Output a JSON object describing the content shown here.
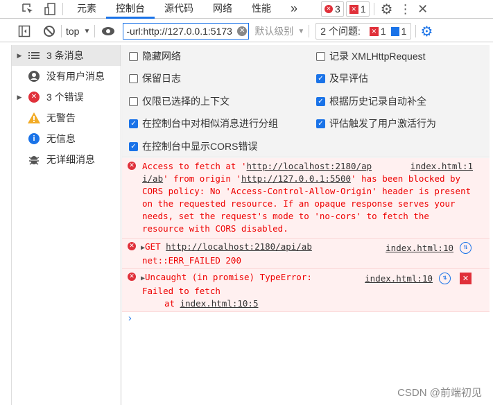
{
  "tabbar": {
    "tabs": [
      "元素",
      "控制台",
      "源代码",
      "网络",
      "性能"
    ],
    "more": "»",
    "error_count": "3",
    "issue_count": "1",
    "active_tab": "控制台"
  },
  "toolbar": {
    "context": "top",
    "filter_value": "-url:http://127.0.0.1:5173",
    "level": "默认级别",
    "issues_label": "2 个问题:",
    "issues_error": "1",
    "issues_info": "1"
  },
  "sidebar": {
    "items": [
      {
        "label": "3 条消息",
        "icon": "list-icon",
        "expandable": true,
        "selected": true
      },
      {
        "label": "没有用户消息",
        "icon": "user-icon",
        "expandable": false
      },
      {
        "label": "3 个错误",
        "icon": "error-icon",
        "expandable": true
      },
      {
        "label": "无警告",
        "icon": "warning-icon",
        "expandable": false
      },
      {
        "label": "无信息",
        "icon": "info-icon",
        "expandable": false
      },
      {
        "label": "无详细消息",
        "icon": "bug-icon",
        "expandable": false
      }
    ]
  },
  "settings": {
    "options": [
      {
        "label": "隐藏网络",
        "checked": false
      },
      {
        "label": "记录 XMLHttpRequest",
        "checked": false
      },
      {
        "label": "保留日志",
        "checked": false
      },
      {
        "label": "及早评估",
        "checked": true
      },
      {
        "label": "仅限已选择的上下文",
        "checked": false
      },
      {
        "label": "根据历史记录自动补全",
        "checked": true
      },
      {
        "label": "在控制台中对相似消息进行分组",
        "checked": true
      },
      {
        "label": "评估触发了用户激活行为",
        "checked": true
      },
      {
        "label": "在控制台中显示CORS错误",
        "checked": true
      }
    ]
  },
  "messages": [
    {
      "t1": "Access to fetch at '",
      "u1": "http://localhost:2180/ap",
      "src": "index.html:1",
      "u2": "i/ab",
      "t2": "' from origin '",
      "u3": "http://127.0.0.1:5500",
      "t3": "' has been blocked by CORS policy: No 'Access-Control-Allow-Origin' header is present on the requested resource. If an opaque response serves your needs, set the request's mode to 'no-cors' to fetch the resource with CORS disabled."
    },
    {
      "method": "GET",
      "url": "http://localhost:2180/api/ab",
      "status": "net::ERR_FAILED 200",
      "src": "index.html:10"
    },
    {
      "text": "Uncaught (in promise) TypeError:",
      "text2": "Failed to fetch",
      "at": "at",
      "loc": "index.html:10:5",
      "src": "index.html:10"
    }
  ],
  "colors": {
    "accent": "#1a73e8",
    "error": "#e00000",
    "error_bg": "#fff0f0"
  },
  "watermark": "CSDN @前端初见"
}
